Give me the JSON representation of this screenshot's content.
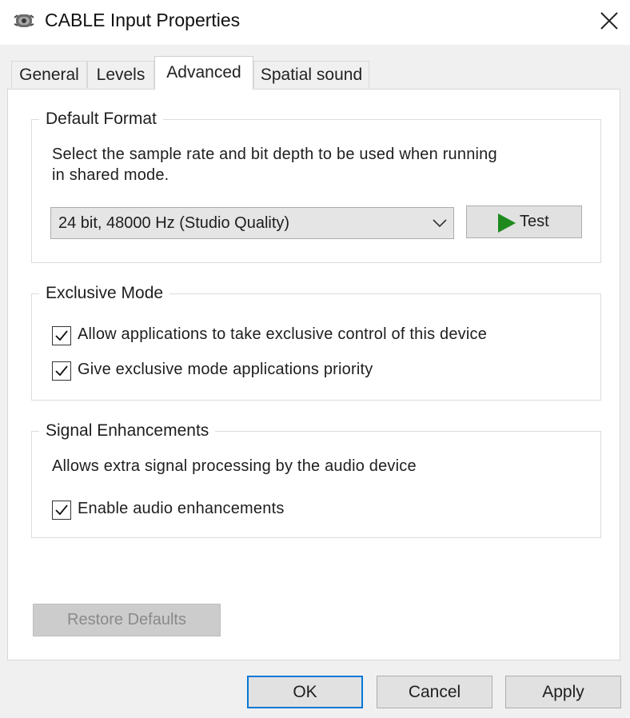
{
  "window": {
    "title": "CABLE Input Properties",
    "icon": "speaker-icon",
    "close_icon": "close-icon"
  },
  "tabs": [
    {
      "label": "General",
      "active": false
    },
    {
      "label": "Levels",
      "active": false
    },
    {
      "label": "Advanced",
      "active": true
    },
    {
      "label": "Spatial sound",
      "active": false
    }
  ],
  "default_format": {
    "title": "Default Format",
    "description_line1": "Select the sample rate and bit depth to be used when running",
    "description_line2": "in shared mode.",
    "selected_format": "24 bit, 48000 Hz (Studio Quality)",
    "test_label": "Test",
    "test_icon": "play-icon",
    "play_color": "#1e8a1e"
  },
  "exclusive_mode": {
    "title": "Exclusive Mode",
    "allow_exclusive": {
      "label": "Allow applications to take exclusive control of this device",
      "checked": true
    },
    "give_priority": {
      "label": "Give exclusive mode applications priority",
      "checked": true
    }
  },
  "signal_enhancements": {
    "title": "Signal Enhancements",
    "description": "Allows extra signal processing by the audio device",
    "enable": {
      "label": "Enable audio enhancements",
      "checked": true
    }
  },
  "restore_defaults_label": "Restore Defaults",
  "footer": {
    "ok_label": "OK",
    "cancel_label": "Cancel",
    "apply_label": "Apply"
  },
  "colors": {
    "focus_border": "#0078d7",
    "background": "#f0f0f0",
    "panel": "#ffffff"
  }
}
